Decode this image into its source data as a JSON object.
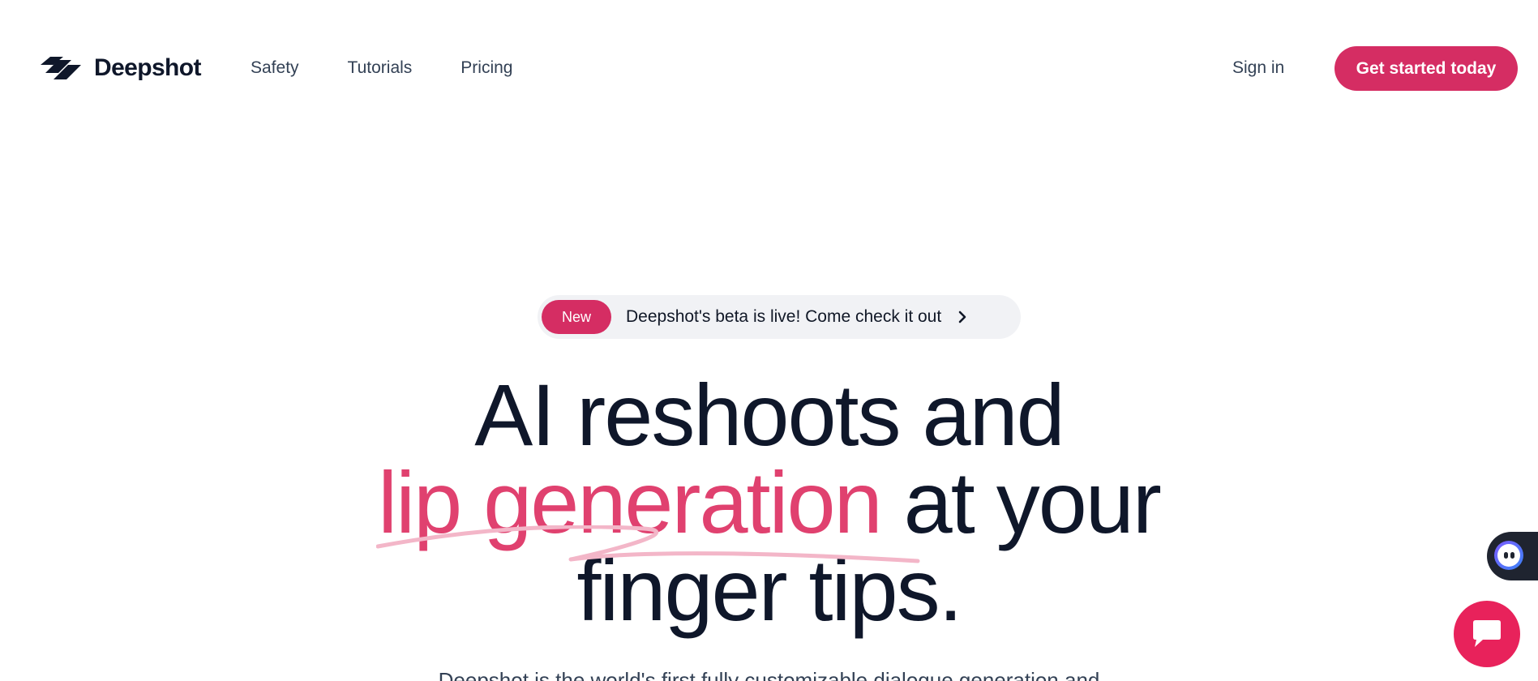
{
  "header": {
    "brand": "Deepshot",
    "nav": [
      {
        "label": "Safety"
      },
      {
        "label": "Tutorials"
      },
      {
        "label": "Pricing"
      }
    ],
    "sign_in": "Sign in",
    "cta": "Get started today"
  },
  "announcement": {
    "badge": "New",
    "text": "Deepshot's beta is live! Come check it out",
    "icon": "chevron-right-icon"
  },
  "hero": {
    "line1": "AI reshoots and",
    "accent": "lip generation",
    "line2_rest": " at your",
    "line3": "finger tips.",
    "subtitle": "Deepshot is the world's first fully customizable dialogue generation and"
  },
  "widgets": {
    "assistant_icon": "assistant-face-icon",
    "chat_icon": "chat-icon"
  },
  "colors": {
    "accent": "#d52d63",
    "accent_text": "#e0416f",
    "heading": "#0f172a",
    "body": "#334155",
    "pill_bg": "#f1f2f5",
    "chat_bubble": "#e8225b"
  }
}
